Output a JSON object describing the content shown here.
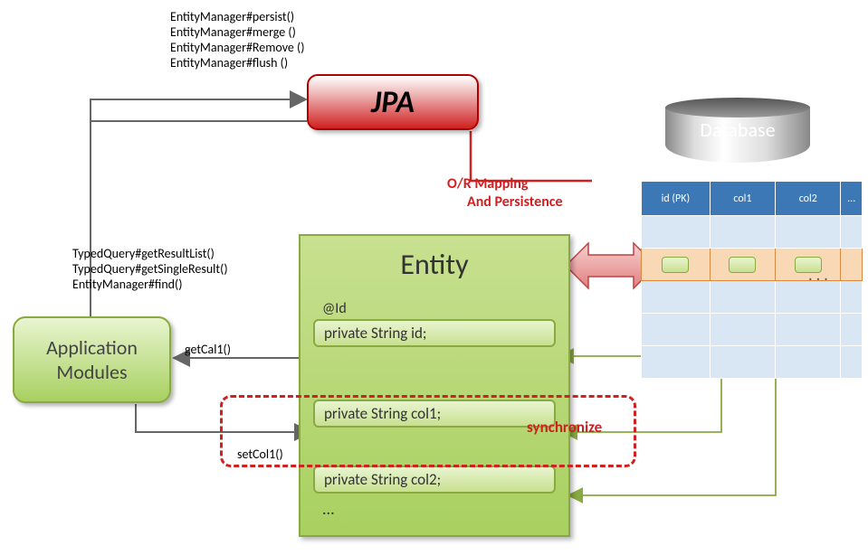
{
  "em_methods": [
    "EntityManager#persist()",
    "EntityManager#merge ()",
    "EntityManager#Remove ()",
    "EntityManager#flush ()"
  ],
  "jpa": {
    "label": "JPA"
  },
  "database": {
    "label": "Database"
  },
  "db_headers": [
    "id\n(PK)",
    "col1",
    "col2",
    "..."
  ],
  "ormap": {
    "line1": "O/R Mapping",
    "line2": "And Persistence"
  },
  "entity": {
    "title": "Entity",
    "anno": "@Id",
    "field1": "private String id;",
    "field2": "private String col1;",
    "field3": "private String col2;",
    "ellipsis": "..."
  },
  "tq_methods": [
    "TypedQuery#getResultList()",
    "TypedQuery#getSingleResult()",
    "EntityManager#find()"
  ],
  "app": {
    "line1": "Application",
    "line2": "Modules"
  },
  "labels": {
    "getCal": "getCal1()",
    "setCol": "setCol1()",
    "sync": "synchronize",
    "dots": ". . ."
  }
}
